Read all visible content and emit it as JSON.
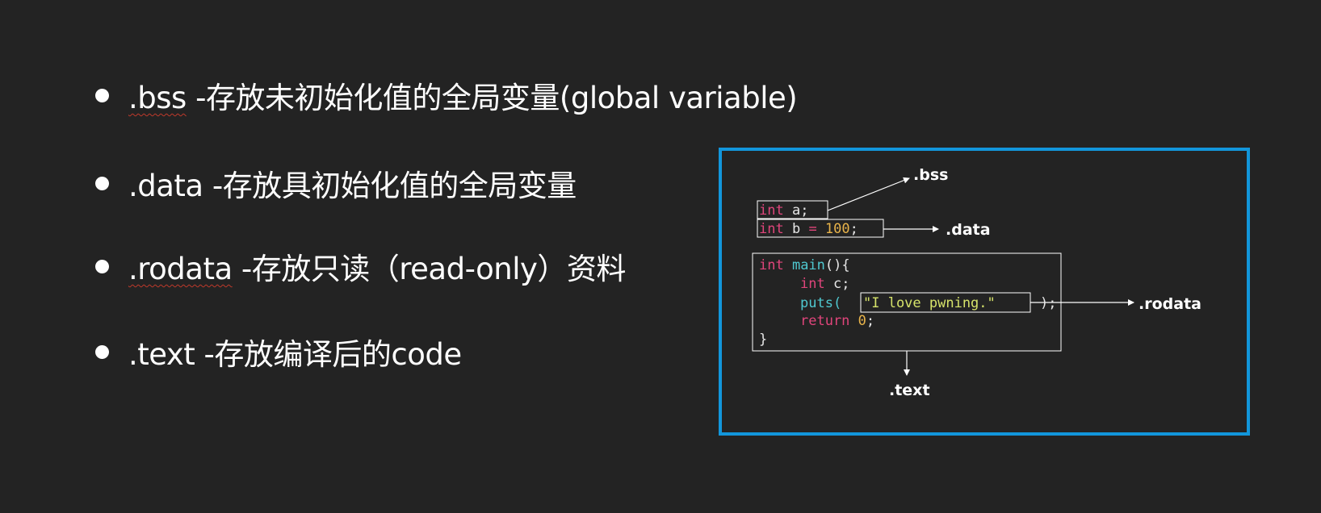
{
  "bullets": [
    {
      "term": ".bss",
      "sep": " -",
      "desc": "存放未初始化值的全局变量(global variable)"
    },
    {
      "term": ".data",
      "sep": " -",
      "desc": "存放具初始化值的全局变量"
    },
    {
      "term": ".rodata",
      "sep": " -",
      "desc": "存放只读（read-only）资料"
    },
    {
      "term": ".text",
      "sep": " -",
      "desc": "存放编译后的code"
    }
  ],
  "diagram": {
    "labels": {
      "bss": ".bss",
      "data": ".data",
      "rodata": ".rodata",
      "text": ".text"
    },
    "code": {
      "kw_int": "int",
      "line_a_rest": " a;",
      "line_b_mid": " b ",
      "eq": "=",
      "num_100": " 100",
      "semi": ";",
      "main_name": " main",
      "main_paren": "(){",
      "c_rest": " c;",
      "puts": "puts(",
      "str": "\"I love pwning.\"",
      "puts_close": ");",
      "kw_return": "return",
      "num_0": " 0",
      "close_brace": "}"
    }
  },
  "colors": {
    "background": "#232323",
    "frame": "#1296db",
    "keyword": "#e0457b",
    "function": "#4fc8d0",
    "string": "#d6e36a",
    "number": "#e8b34a",
    "plain": "#e6e6e6"
  }
}
